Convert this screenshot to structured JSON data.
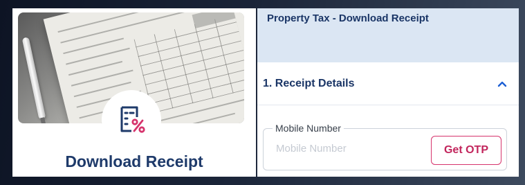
{
  "card": {
    "title": "Download Receipt",
    "image": "tax-form-with-pen",
    "icon": "receipt-percent-icon"
  },
  "panel": {
    "title": "Property Tax - Download Receipt",
    "section": {
      "title": "1. Receipt Details",
      "toggle_icon": "chevron-up-icon",
      "expanded": true
    },
    "mobile_field": {
      "label": "Mobile Number",
      "placeholder": "Mobile Number",
      "value": ""
    },
    "otp_button_label": "Get OTP"
  },
  "colors": {
    "navy": "#1e3a6a",
    "accent": "#d6336c",
    "header_bg": "#dbe6f3",
    "background": "#0d1424"
  }
}
